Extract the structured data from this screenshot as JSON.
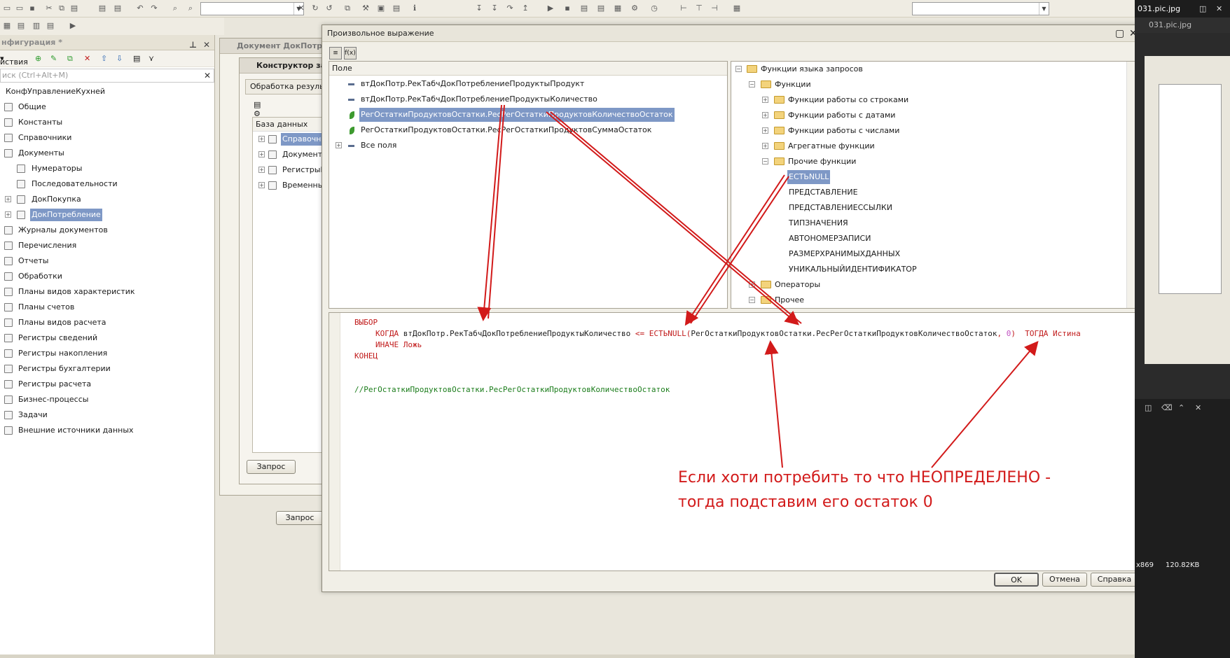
{
  "toolbar": {
    "search_value": "",
    "right_combo_value": ""
  },
  "config_panel": {
    "title": "нфигурация *",
    "actions_label": "йствия",
    "search_placeholder": "иск (Ctrl+Alt+M)",
    "root": "КонфУправлениеКухней",
    "items": [
      {
        "label": "Общие"
      },
      {
        "label": "Константы"
      },
      {
        "label": "Справочники"
      },
      {
        "label": "Документы"
      },
      {
        "label": "Нумераторы"
      },
      {
        "label": "Последовательности"
      },
      {
        "label": "ДокПокупка"
      },
      {
        "label": "ДокПотребление"
      },
      {
        "label": "Журналы документов"
      },
      {
        "label": "Перечисления"
      },
      {
        "label": "Отчеты"
      },
      {
        "label": "Обработки"
      },
      {
        "label": "Планы видов характеристик"
      },
      {
        "label": "Планы счетов"
      },
      {
        "label": "Планы видов расчета"
      },
      {
        "label": "Регистры сведений"
      },
      {
        "label": "Регистры накопления"
      },
      {
        "label": "Регистры бухгалтерии"
      },
      {
        "label": "Регистры расчета"
      },
      {
        "label": "Бизнес-процессы"
      },
      {
        "label": "Задачи"
      },
      {
        "label": "Внешние источники данных"
      }
    ]
  },
  "bg_windows": {
    "doc_title": "Документ ДокПотреб",
    "constructor_title": "Конструктор зап",
    "processing_tab": "Обработка резуль",
    "db_header": "База данных",
    "db_items": [
      "Справочн",
      "Документ",
      "РегистрыН",
      "Временны"
    ],
    "query_button": "Запрос",
    "query_button2": "Запрос"
  },
  "dialog": {
    "title": "Произвольное выражение",
    "fields_header": "Поле",
    "fields": [
      "втДокПотр.РекТабчДокПотреблениеПродуктыПродукт",
      "втДокПотр.РекТабчДокПотреблениеПродуктыКоличество",
      "РегОстаткиПродуктовОстатки.РесРегОстаткиПродуктовКоличествоОстаток",
      "РегОстаткиПродуктовОстатки.РесРегОстаткиПродуктовСуммаОстаток",
      "Все поля"
    ],
    "functions": {
      "root": "Функции языка запросов",
      "functions_folder": "Функции",
      "groups": [
        "Функции работы со строками",
        "Функции работы с датами",
        "Функции работы с числами",
        "Агрегатные функции",
        "Прочие функции"
      ],
      "other_functions": [
        "ЕСТЬNULL",
        "ПРЕДСТАВЛЕНИЕ",
        "ПРЕДСТАВЛЕНИЕССЫЛКИ",
        "ТИПЗНАЧЕНИЯ",
        "АВТОНОМЕРЗАПИСИ",
        "РАЗМЕРХРАНИМЫХДАННЫХ",
        "УНИКАЛЬНЫЙИДЕНТИФИКАТОР"
      ],
      "operators": "Операторы",
      "other": "Прочее"
    },
    "code": {
      "l1": "ВЫБОР",
      "l2_kw": "КОГДА",
      "l2_field": "втДокПотр.РекТабчДокПотреблениеПродуктыКоличество",
      "l2_op": "<=",
      "l2_func": "ЕСТЬNULL",
      "l2_arg": "РегОстаткиПродуктовОстатки.РесРегОстаткиПродуктовКоличествоОстаток",
      "l2_num": "0",
      "l2_then": "ТОГДА",
      "l2_true": "Истина",
      "l3_else": "ИНАЧЕ",
      "l3_false": "Ложь",
      "l4": "КОНЕЦ",
      "comment": "//РегОстаткиПродуктовОстатки.РесРегОстаткиПродуктовКоличествоОстаток"
    },
    "annotation_line1": "Если хоти потребить то что НЕОПРЕДЕЛЕНО -",
    "annotation_line2": "тогда подставим его остаток 0",
    "ok": "OK",
    "cancel": "Отмена",
    "help": "Справка"
  },
  "viewer": {
    "title": "031.pic.jpg",
    "tab": "031.pic.jpg",
    "status_size": "x869",
    "status_filesize": "120.82KB"
  },
  "annotation_color": "#d21a1a",
  "selection_color": "#7e98c6"
}
